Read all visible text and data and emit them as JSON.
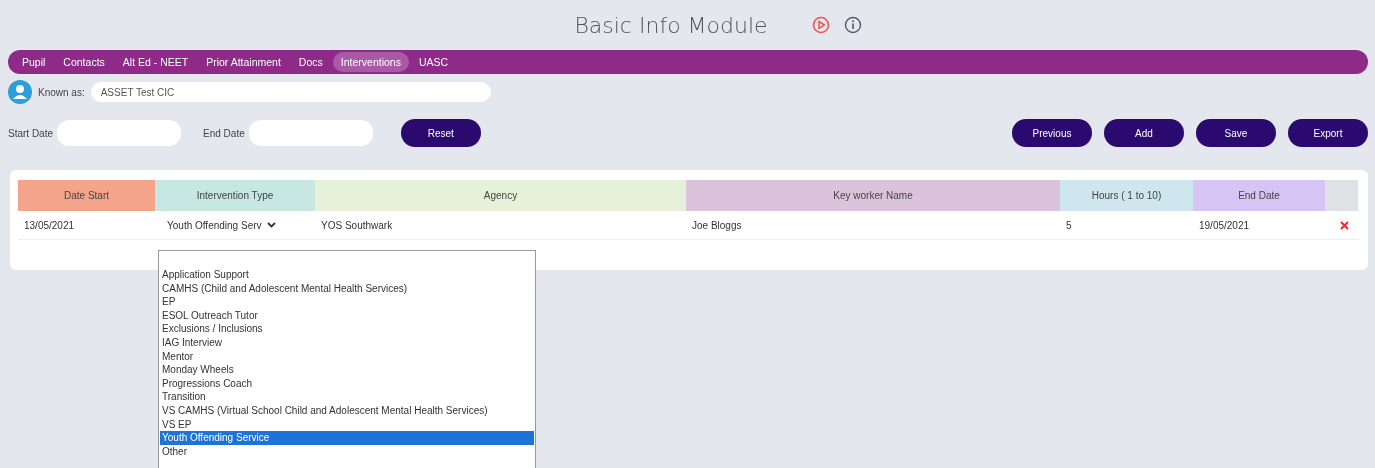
{
  "title": "Basic Info Module",
  "tabs": [
    {
      "label": "Pupil",
      "selected": false
    },
    {
      "label": "Contacts",
      "selected": false
    },
    {
      "label": "Alt Ed - NEET",
      "selected": false
    },
    {
      "label": "Prior Attainment",
      "selected": false
    },
    {
      "label": "Docs",
      "selected": false
    },
    {
      "label": "Interventions",
      "selected": true
    },
    {
      "label": "UASC",
      "selected": false
    }
  ],
  "known_as": {
    "label": "Known as:",
    "value": "ASSET Test CIC"
  },
  "filters": [
    {
      "label": "Start Date"
    },
    {
      "label": "End Date"
    }
  ],
  "reset_button": "Reset",
  "actions": [
    "Previous",
    "Add",
    "Save",
    "Export"
  ],
  "table": {
    "columns": [
      {
        "label": "Date Start",
        "color": "#f4a48a"
      },
      {
        "label": "Intervention Type",
        "color": "#c6e7e2"
      },
      {
        "label": "Agency",
        "color": "#e5f2d9"
      },
      {
        "label": "Key worker Name",
        "color": "#dbc3dc"
      },
      {
        "label": "Hours ( 1 to 10)",
        "color": "#cee6ee"
      },
      {
        "label": "End Date",
        "color": "#d7c3f4"
      }
    ],
    "rows": [
      {
        "date_start": "13/05/2021",
        "intervention_type": "Youth Offending Serv",
        "agency": "YOS Southwark",
        "key_worker": "Joe Bloggs",
        "hours": "5",
        "end_date": "19/05/2021"
      }
    ]
  },
  "dropdown_options": [
    {
      "label": "Application Support",
      "selected": false
    },
    {
      "label": "CAMHS (Child and Adolescent Mental Health Services)",
      "selected": false
    },
    {
      "label": "EP",
      "selected": false
    },
    {
      "label": "ESOL Outreach Tutor",
      "selected": false
    },
    {
      "label": "Exclusions / Inclusions",
      "selected": false
    },
    {
      "label": "IAG Interview",
      "selected": false
    },
    {
      "label": "Mentor",
      "selected": false
    },
    {
      "label": "Monday Wheels",
      "selected": false
    },
    {
      "label": "Progressions Coach",
      "selected": false
    },
    {
      "label": "Transition",
      "selected": false
    },
    {
      "label": "VS CAMHS (Virtual School Child and Adolescent Mental Health Services)",
      "selected": false
    },
    {
      "label": "VS EP",
      "selected": false
    },
    {
      "label": "Youth Offending Service",
      "selected": true
    },
    {
      "label": "Other",
      "selected": false
    }
  ]
}
